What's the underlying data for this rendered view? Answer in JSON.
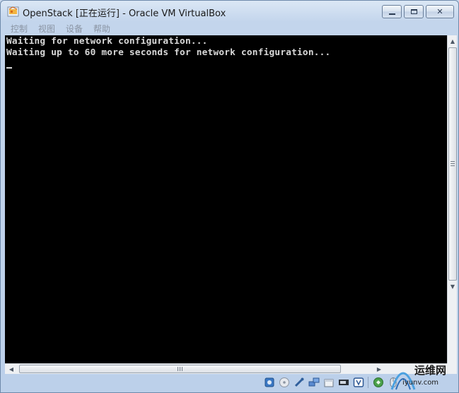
{
  "window": {
    "title": "OpenStack [正在运行] - Oracle VM VirtualBox",
    "buttons": {
      "minimize": "▭",
      "maximize": "▢",
      "close": "✕"
    }
  },
  "menubar": {
    "items": [
      "控制",
      "视图",
      "设备",
      "帮助"
    ]
  },
  "console": {
    "lines": [
      "Waiting for network configuration...",
      "Waiting up to 60 more seconds for network configuration..."
    ]
  },
  "statusbar": {
    "icons": [
      "hard-disk-icon",
      "optical-drive-icon",
      "usb-icon",
      "network-icon",
      "shared-folder-icon",
      "display-icon",
      "video-capture-icon",
      "virtualization-icon",
      "mouse-integration-icon",
      "host-key-icon"
    ]
  },
  "watermark": {
    "title": "运维网",
    "subtitle": "iyunv.com"
  },
  "colors": {
    "console_bg": "#000000",
    "console_fg": "#d8d8d8",
    "chrome": "#c3d5ec"
  }
}
